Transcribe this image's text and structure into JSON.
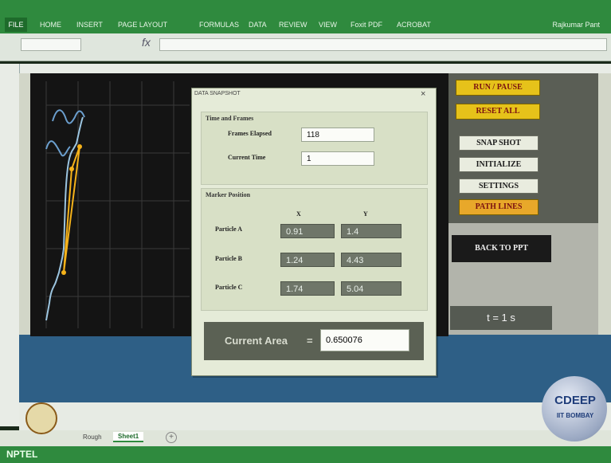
{
  "ribbon": {
    "file": "FILE",
    "tabs": [
      "HOME",
      "INSERT",
      "PAGE LAYOUT",
      "FORMULAS",
      "DATA",
      "REVIEW",
      "VIEW",
      "Foxit PDF",
      "ACROBAT"
    ],
    "user": "Rajkumar Pant"
  },
  "formula_bar": {
    "fx": "fx"
  },
  "right_buttons": {
    "run_pause": "RUN / PAUSE",
    "reset_all": "RESET ALL",
    "snap_shot": "SNAP SHOT",
    "initialize": "INITIALIZE",
    "settings": "SETTINGS",
    "path_lines": "PATH LINES",
    "back_to_ppt": "BACK TO PPT"
  },
  "time_readout": "t = 1 s",
  "dialog": {
    "title": "DATA SNAPSHOT",
    "close": "×",
    "time_group": "Time and Frames",
    "frames_elapsed_label": "Frames Elapsed",
    "frames_elapsed_value": "118",
    "current_time_label": "Current Time",
    "current_time_value": "1",
    "marker_group": "Marker Position",
    "col_x": "X",
    "col_y": "Y",
    "particles": [
      {
        "label": "Particle A",
        "x": "0.91",
        "y": "1.4"
      },
      {
        "label": "Particle B",
        "x": "1.24",
        "y": "4.43"
      },
      {
        "label": "Particle C",
        "x": "1.74",
        "y": "5.04"
      }
    ],
    "area_label": "Current Area",
    "area_eq": "=",
    "area_value": "0.650076"
  },
  "sheet_tabs": [
    "Rough",
    "Sheet1"
  ],
  "status": {
    "brand": "NPTEL"
  },
  "watermark": {
    "title": "CDEEP",
    "subtitle": "IIT BOMBAY"
  },
  "colors": {
    "ribbon_green": "#2f8a3e",
    "button_yellow": "#e6c21a",
    "plot_line": "#f5b21a",
    "plot_curve": "#7fb3d9"
  }
}
